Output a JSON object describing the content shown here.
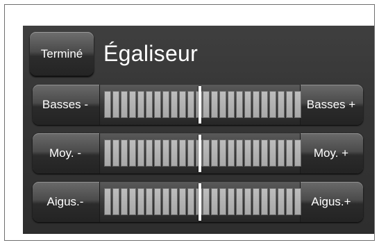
{
  "header": {
    "done_label": "Terminé",
    "title": "Égaliseur"
  },
  "bands": [
    {
      "minus_label": "Basses -",
      "plus_label": "Basses +",
      "level": 0.5,
      "segments_per_side": 12
    },
    {
      "minus_label": "Moy.  -",
      "plus_label": "Moy.  +",
      "level": 0.5,
      "segments_per_side": 12
    },
    {
      "minus_label": "Aigus.-",
      "plus_label": "Aigus.+",
      "level": 0.5,
      "segments_per_side": 12
    }
  ]
}
